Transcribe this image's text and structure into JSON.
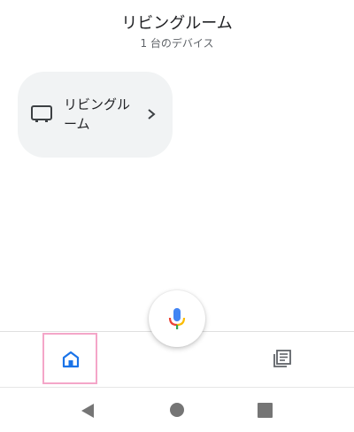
{
  "header": {
    "title": "リビングルーム",
    "subtitle": "1 台のデバイス"
  },
  "rooms": [
    {
      "label": "リビングルーム",
      "icon": "tv-icon"
    }
  ],
  "assistant": {
    "icon": "microphone-icon"
  },
  "bottom_nav": {
    "items": [
      {
        "icon": "home-icon",
        "selected": true
      },
      {
        "icon": "feed-icon",
        "selected": false
      }
    ]
  },
  "system_nav": {
    "items": [
      "back-icon",
      "home-circle-icon",
      "recents-icon"
    ]
  },
  "colors": {
    "accent": "#1a73e8",
    "card_bg": "#f1f3f4",
    "highlight_border": "#f4a6c8",
    "mic_blue": "#4285f4",
    "mic_red": "#ea4335",
    "mic_yellow": "#fbbc04",
    "mic_green": "#34a853"
  }
}
